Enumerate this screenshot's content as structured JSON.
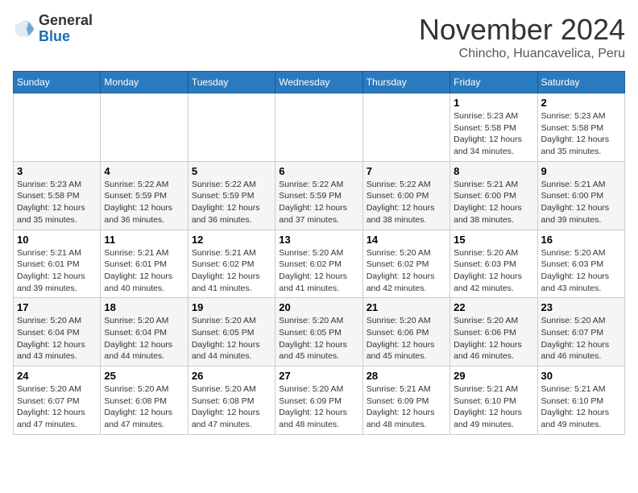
{
  "header": {
    "logo_general": "General",
    "logo_blue": "Blue",
    "month_title": "November 2024",
    "location": "Chincho, Huancavelica, Peru"
  },
  "days_of_week": [
    "Sunday",
    "Monday",
    "Tuesday",
    "Wednesday",
    "Thursday",
    "Friday",
    "Saturday"
  ],
  "weeks": [
    [
      {
        "day": "",
        "info": ""
      },
      {
        "day": "",
        "info": ""
      },
      {
        "day": "",
        "info": ""
      },
      {
        "day": "",
        "info": ""
      },
      {
        "day": "",
        "info": ""
      },
      {
        "day": "1",
        "info": "Sunrise: 5:23 AM\nSunset: 5:58 PM\nDaylight: 12 hours and 34 minutes."
      },
      {
        "day": "2",
        "info": "Sunrise: 5:23 AM\nSunset: 5:58 PM\nDaylight: 12 hours and 35 minutes."
      }
    ],
    [
      {
        "day": "3",
        "info": "Sunrise: 5:23 AM\nSunset: 5:58 PM\nDaylight: 12 hours and 35 minutes."
      },
      {
        "day": "4",
        "info": "Sunrise: 5:22 AM\nSunset: 5:59 PM\nDaylight: 12 hours and 36 minutes."
      },
      {
        "day": "5",
        "info": "Sunrise: 5:22 AM\nSunset: 5:59 PM\nDaylight: 12 hours and 36 minutes."
      },
      {
        "day": "6",
        "info": "Sunrise: 5:22 AM\nSunset: 5:59 PM\nDaylight: 12 hours and 37 minutes."
      },
      {
        "day": "7",
        "info": "Sunrise: 5:22 AM\nSunset: 6:00 PM\nDaylight: 12 hours and 38 minutes."
      },
      {
        "day": "8",
        "info": "Sunrise: 5:21 AM\nSunset: 6:00 PM\nDaylight: 12 hours and 38 minutes."
      },
      {
        "day": "9",
        "info": "Sunrise: 5:21 AM\nSunset: 6:00 PM\nDaylight: 12 hours and 39 minutes."
      }
    ],
    [
      {
        "day": "10",
        "info": "Sunrise: 5:21 AM\nSunset: 6:01 PM\nDaylight: 12 hours and 39 minutes."
      },
      {
        "day": "11",
        "info": "Sunrise: 5:21 AM\nSunset: 6:01 PM\nDaylight: 12 hours and 40 minutes."
      },
      {
        "day": "12",
        "info": "Sunrise: 5:21 AM\nSunset: 6:02 PM\nDaylight: 12 hours and 41 minutes."
      },
      {
        "day": "13",
        "info": "Sunrise: 5:20 AM\nSunset: 6:02 PM\nDaylight: 12 hours and 41 minutes."
      },
      {
        "day": "14",
        "info": "Sunrise: 5:20 AM\nSunset: 6:02 PM\nDaylight: 12 hours and 42 minutes."
      },
      {
        "day": "15",
        "info": "Sunrise: 5:20 AM\nSunset: 6:03 PM\nDaylight: 12 hours and 42 minutes."
      },
      {
        "day": "16",
        "info": "Sunrise: 5:20 AM\nSunset: 6:03 PM\nDaylight: 12 hours and 43 minutes."
      }
    ],
    [
      {
        "day": "17",
        "info": "Sunrise: 5:20 AM\nSunset: 6:04 PM\nDaylight: 12 hours and 43 minutes."
      },
      {
        "day": "18",
        "info": "Sunrise: 5:20 AM\nSunset: 6:04 PM\nDaylight: 12 hours and 44 minutes."
      },
      {
        "day": "19",
        "info": "Sunrise: 5:20 AM\nSunset: 6:05 PM\nDaylight: 12 hours and 44 minutes."
      },
      {
        "day": "20",
        "info": "Sunrise: 5:20 AM\nSunset: 6:05 PM\nDaylight: 12 hours and 45 minutes."
      },
      {
        "day": "21",
        "info": "Sunrise: 5:20 AM\nSunset: 6:06 PM\nDaylight: 12 hours and 45 minutes."
      },
      {
        "day": "22",
        "info": "Sunrise: 5:20 AM\nSunset: 6:06 PM\nDaylight: 12 hours and 46 minutes."
      },
      {
        "day": "23",
        "info": "Sunrise: 5:20 AM\nSunset: 6:07 PM\nDaylight: 12 hours and 46 minutes."
      }
    ],
    [
      {
        "day": "24",
        "info": "Sunrise: 5:20 AM\nSunset: 6:07 PM\nDaylight: 12 hours and 47 minutes."
      },
      {
        "day": "25",
        "info": "Sunrise: 5:20 AM\nSunset: 6:08 PM\nDaylight: 12 hours and 47 minutes."
      },
      {
        "day": "26",
        "info": "Sunrise: 5:20 AM\nSunset: 6:08 PM\nDaylight: 12 hours and 47 minutes."
      },
      {
        "day": "27",
        "info": "Sunrise: 5:20 AM\nSunset: 6:09 PM\nDaylight: 12 hours and 48 minutes."
      },
      {
        "day": "28",
        "info": "Sunrise: 5:21 AM\nSunset: 6:09 PM\nDaylight: 12 hours and 48 minutes."
      },
      {
        "day": "29",
        "info": "Sunrise: 5:21 AM\nSunset: 6:10 PM\nDaylight: 12 hours and 49 minutes."
      },
      {
        "day": "30",
        "info": "Sunrise: 5:21 AM\nSunset: 6:10 PM\nDaylight: 12 hours and 49 minutes."
      }
    ]
  ]
}
